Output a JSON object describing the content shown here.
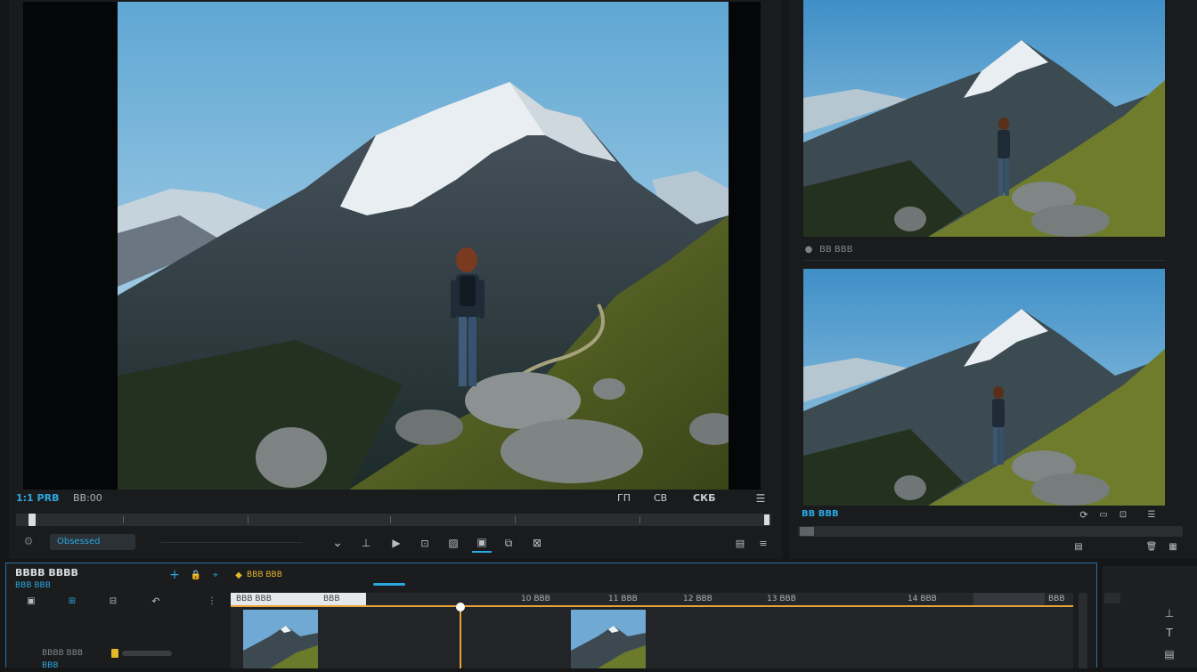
{
  "main_viewer": {
    "timecode_label": "1:1 PRB",
    "tc_value": "BB:00",
    "right_labels": [
      "ГП",
      "СВ",
      "СКБ"
    ],
    "zoom_field": "Obsessed"
  },
  "preview_top": {
    "label": "BB BBB"
  },
  "preview_bottom": {
    "label": "BB BBB"
  },
  "timeline": {
    "title": "BBBB BBBB",
    "sub": "BBB BBB",
    "clip_label": "BBB BBB",
    "ruler_labels": [
      "BBB BBB",
      "BBB",
      "10 BBB",
      "11 BBB",
      "12 BBB",
      "13 BBB",
      "14 BBB",
      "BBB"
    ],
    "track_label_1": "BBBB BBB",
    "track_label_2": "BBB",
    "progress_fill": 0.27
  },
  "colors": {
    "accent": "#2aa8e0",
    "playhead": "#e8a23a",
    "panel": "#1d1f21",
    "bg": "#151617"
  }
}
